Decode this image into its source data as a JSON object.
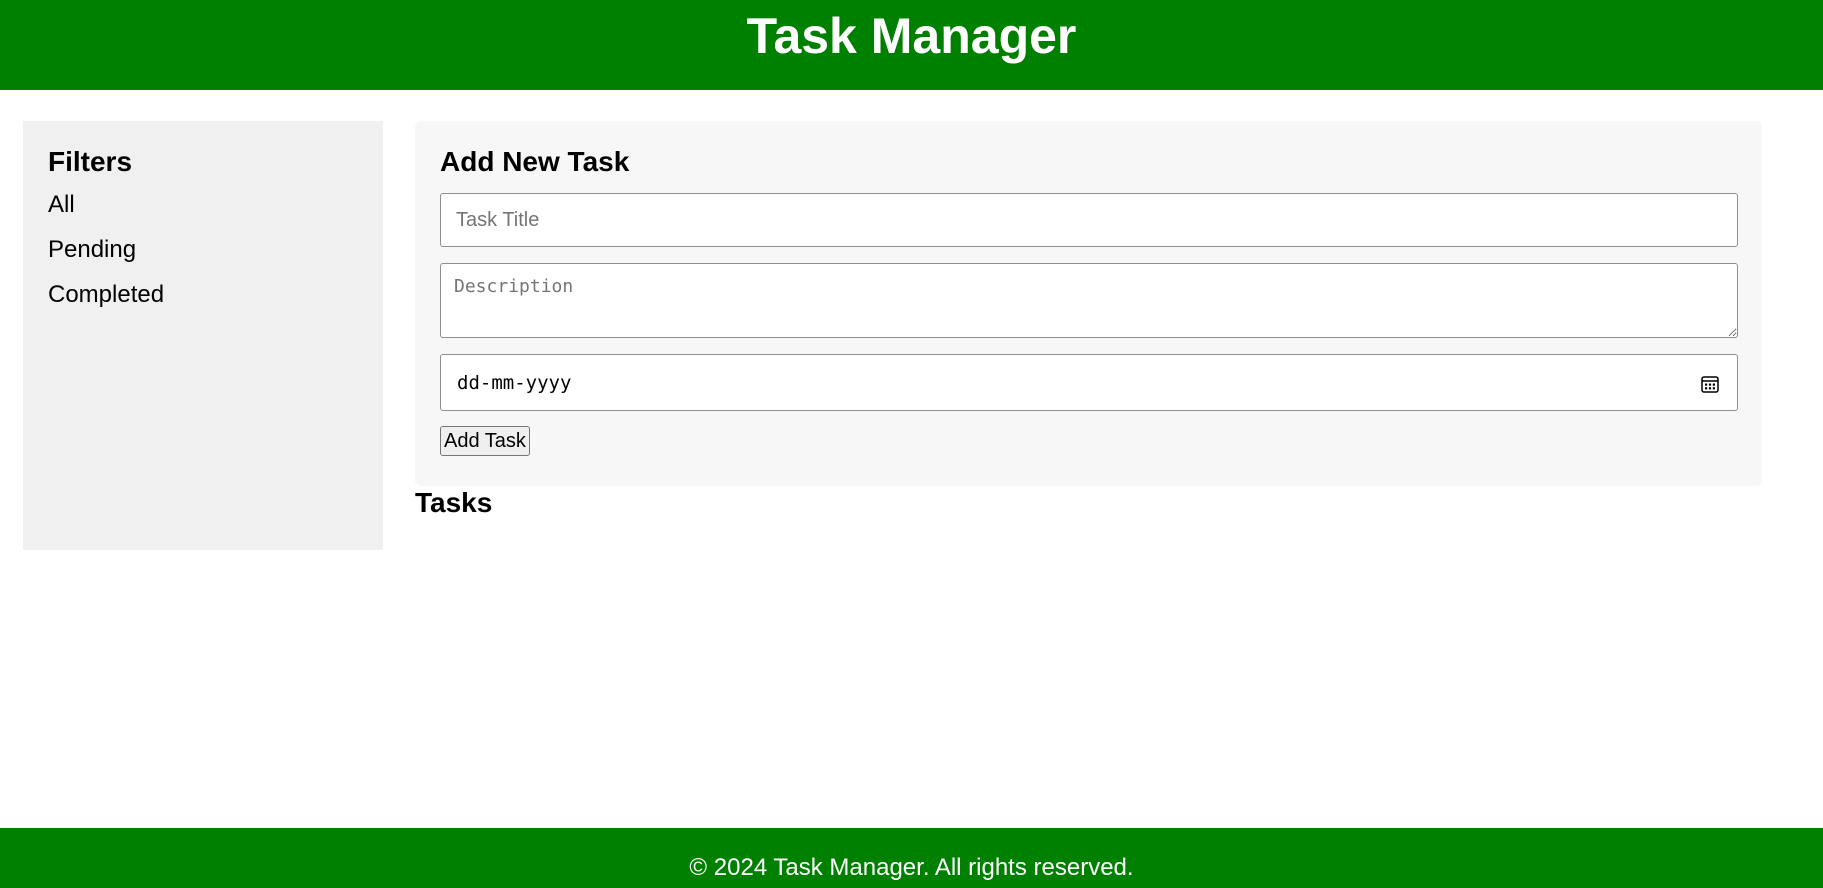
{
  "header": {
    "title": "Task Manager"
  },
  "sidebar": {
    "heading": "Filters",
    "filters": [
      {
        "label": "All"
      },
      {
        "label": "Pending"
      },
      {
        "label": "Completed"
      }
    ]
  },
  "task_form": {
    "heading": "Add New Task",
    "title_placeholder": "Task Title",
    "description_placeholder": "Description",
    "date_placeholder": "dd-mm-yyyy",
    "date_icon": "calendar-icon",
    "submit_label": "Add Task"
  },
  "tasks": {
    "heading": "Tasks",
    "items": []
  },
  "footer": {
    "text": "© 2024 Task Manager. All rights reserved."
  },
  "colors": {
    "brand_green": "#008000",
    "sidebar_bg": "#f0f0f0",
    "form_bg": "#f7f7f7"
  }
}
